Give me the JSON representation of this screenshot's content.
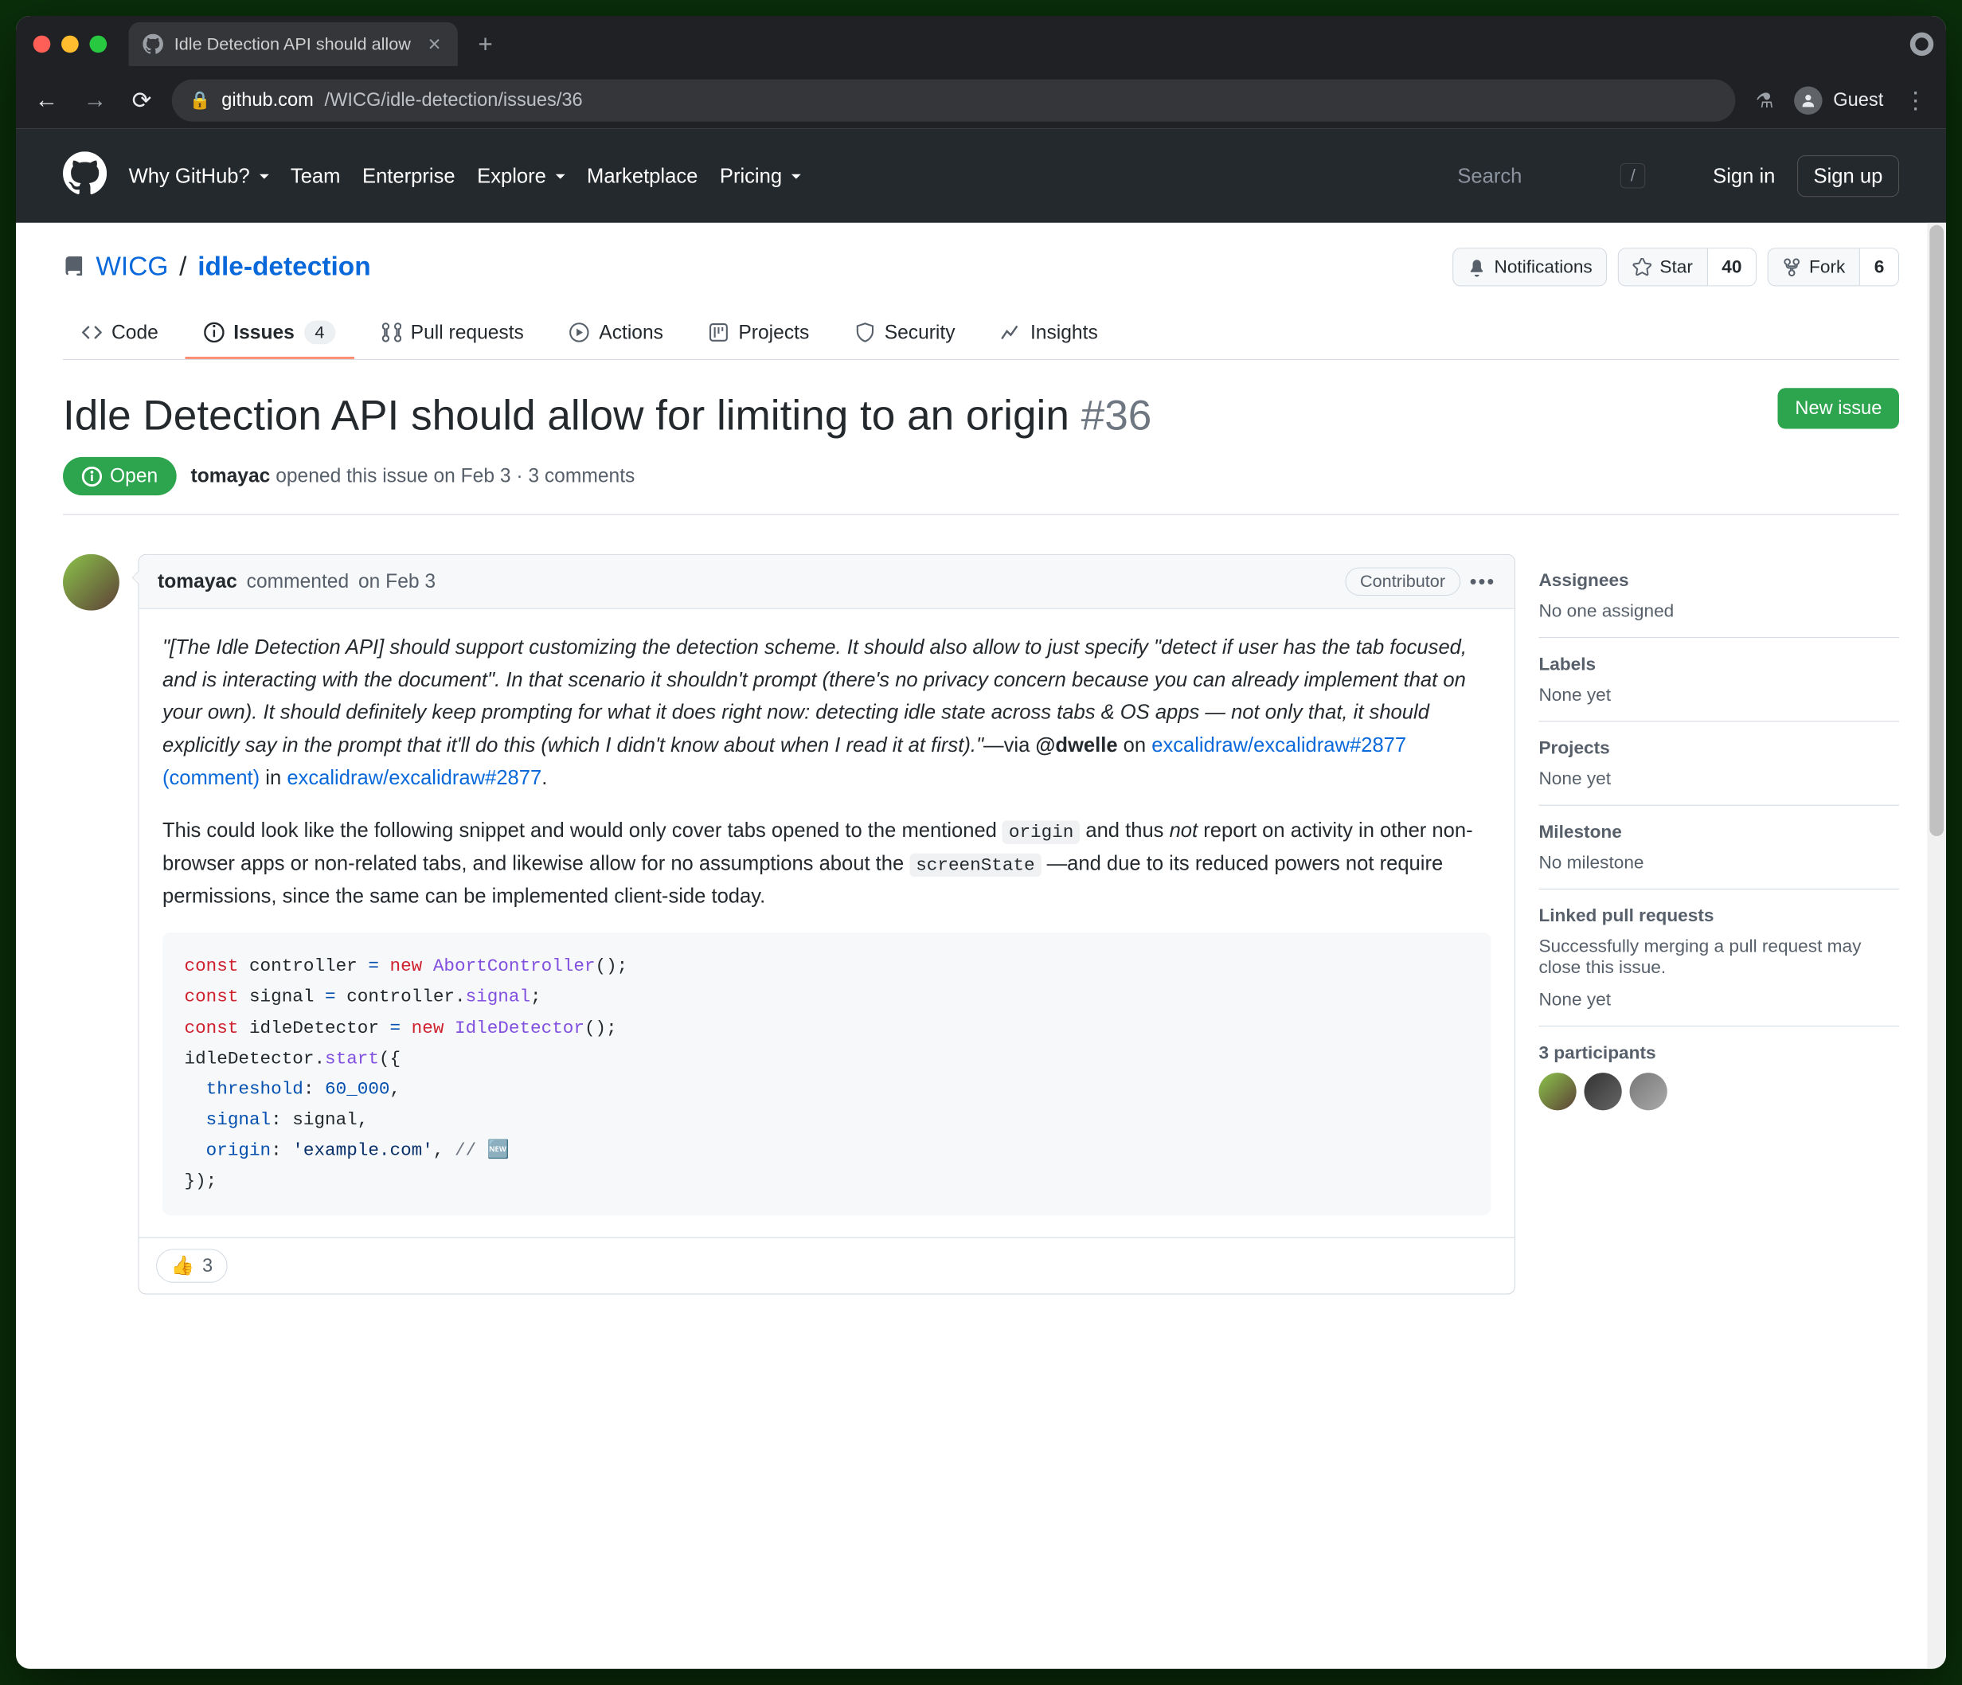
{
  "browser": {
    "tab_title": "Idle Detection API should allow",
    "url_host": "github.com",
    "url_path": "/WICG/idle-detection/issues/36",
    "profile_label": "Guest"
  },
  "gh_nav": {
    "items": [
      "Why GitHub?",
      "Team",
      "Enterprise",
      "Explore",
      "Marketplace",
      "Pricing"
    ],
    "search_placeholder": "Search",
    "slash": "/",
    "sign_in": "Sign in",
    "sign_up": "Sign up"
  },
  "repo": {
    "owner": "WICG",
    "name": "idle-detection",
    "actions": {
      "notifications": "Notifications",
      "star": "Star",
      "star_count": "40",
      "fork": "Fork",
      "fork_count": "6"
    },
    "tabs": {
      "code": "Code",
      "issues": "Issues",
      "issues_count": "4",
      "pulls": "Pull requests",
      "actions": "Actions",
      "projects": "Projects",
      "security": "Security",
      "insights": "Insights"
    }
  },
  "issue": {
    "title": "Idle Detection API should allow for limiting to an origin",
    "number": "#36",
    "new_issue": "New issue",
    "state": "Open",
    "author": "tomayac",
    "meta_text": " opened this issue on Feb 3 · 3 comments"
  },
  "comment": {
    "author": "tomayac",
    "verb": " commented ",
    "time": "on Feb 3",
    "badge": "Contributor",
    "para1_quote": "\"[The Idle Detection API] should support customizing the detection scheme. It should also allow to just specify \"detect if user has the tab focused, and is interacting with the document\". In that scenario it shouldn't prompt (there's no privacy concern because you can already implement that on your own). It should definitely keep prompting for what it does right now: detecting idle state across tabs & OS apps — not only that, it should explicitly say in the prompt that it'll do this (which I didn't know about when I read it at first).\"",
    "via": "—via ",
    "mention": "@dwelle",
    "on": " on ",
    "link1": "excalidraw/excalidraw#2877 (comment)",
    "in": " in ",
    "link2": "excalidraw/excalidraw#2877",
    "para2_a": "This could look like the following snippet and would only cover tabs opened to the mentioned ",
    "code_origin": "origin",
    "para2_b": " and thus ",
    "not": "not",
    "para2_c": " report on activity in other non-browser apps or non-related tabs, and likewise allow for no assumptions about the ",
    "code_screen": "screenState",
    "para2_d": " —and due to its reduced powers not require permissions, since the same can be implemented client-side today.",
    "reaction_emoji": "👍",
    "reaction_count": "3"
  },
  "code": {
    "l1a": "const",
    "l1b": " controller ",
    "l1c": "=",
    "l1d": " new ",
    "l1e": "AbortController",
    "l1f": "();",
    "l2a": "const",
    "l2b": " signal ",
    "l2c": "=",
    "l2d": " controller.",
    "l2e": "signal",
    "l2f": ";",
    "l3a": "const",
    "l3b": " idleDetector ",
    "l3c": "=",
    "l3d": " new ",
    "l3e": "IdleDetector",
    "l3f": "();",
    "l4a": "idleDetector.",
    "l4b": "start",
    "l4c": "({",
    "l5a": "  threshold",
    "l5b": ": ",
    "l5c": "60_000",
    "l5d": ",",
    "l6a": "  signal",
    "l6b": ": signal,",
    "l7a": "  origin",
    "l7b": ": ",
    "l7c": "'example.com'",
    "l7d": ", ",
    "l7e": "// 🆕",
    "l8": "});"
  },
  "sidebar": {
    "assignees_h": "Assignees",
    "assignees_v": "No one assigned",
    "labels_h": "Labels",
    "labels_v": "None yet",
    "projects_h": "Projects",
    "projects_v": "None yet",
    "milestone_h": "Milestone",
    "milestone_v": "No milestone",
    "linked_h": "Linked pull requests",
    "linked_desc": "Successfully merging a pull request may close this issue.",
    "linked_v": "None yet",
    "participants_h": "3 participants"
  }
}
